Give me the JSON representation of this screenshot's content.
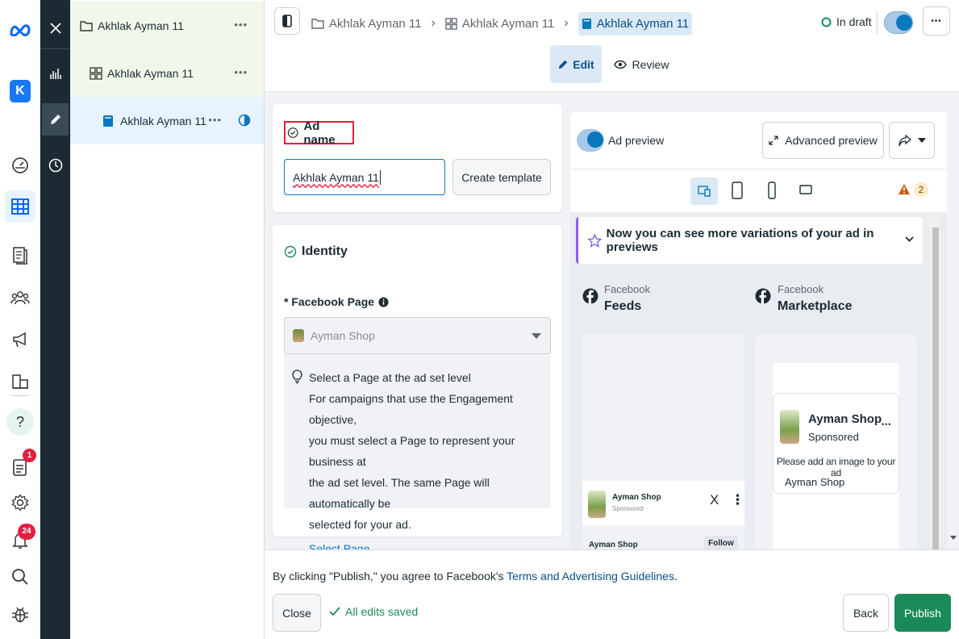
{
  "colors": {
    "accent": "#0a78be",
    "brand_blue": "#0866ff",
    "publish": "#1a8a5a",
    "badge": "#e41e3f",
    "dark_toolbar": "#1c2b33",
    "selected_row": "#e7f3ff",
    "tree_top": "#f1f8e9"
  },
  "rail": {
    "account_initial": "K",
    "notifications_badge": "1",
    "alerts_badge": "24",
    "icons": [
      "meta-logo-icon",
      "account-avatar-icon",
      "dashboard-icon",
      "grid-table-icon",
      "pages-icon",
      "audience-icon",
      "megaphone-icon",
      "catalog-icon",
      "help-icon",
      "notifications-icon",
      "settings-icon",
      "alerts-bell-icon",
      "search-icon",
      "bug-icon"
    ]
  },
  "tree": {
    "campaign": {
      "label": "Akhlak Ayman 11",
      "more": "•••"
    },
    "adset": {
      "label": "Akhlak Ayman 11",
      "more": "•••"
    },
    "ad": {
      "label": "Akhlak Ayman 11",
      "more": "•••"
    }
  },
  "header": {
    "breadcrumb": [
      "Akhlak Ayman 11",
      "Akhlak Ayman 11",
      "Akhlak Ayman 11"
    ],
    "status": "In draft",
    "more": "•••",
    "tabs": {
      "edit": "Edit",
      "review": "Review"
    }
  },
  "ad_name": {
    "title": "Ad name",
    "value": "Akhlak Ayman 11",
    "template_button": "Create template"
  },
  "identity": {
    "title": "Identity",
    "page_label": "* Facebook Page",
    "page_value": "Ayman Shop",
    "info_title": "Select a Page at the ad set level",
    "info_lines": [
      "For campaigns that use the Engagement objective,",
      "you must select a Page to represent your business at",
      "the ad set level. The same Page will automatically be",
      "selected for your ad."
    ],
    "link": "Select Page"
  },
  "preview": {
    "toggle_label": "Ad preview",
    "advanced": "Advanced preview",
    "warning_count": "2",
    "banner": "Now you can see more variations of your ad in previews",
    "placements": [
      {
        "platform": "Facebook",
        "name": "Feeds"
      },
      {
        "platform": "Facebook",
        "name": "Marketplace"
      }
    ],
    "feed_card": {
      "page": "Ayman Shop",
      "sponsored": "Sponsored · ",
      "close": "X",
      "cut_name": "Ayman Shop",
      "follow": "Follow"
    },
    "market_card": {
      "page": "Ayman Shop",
      "sponsored": "Sponsored",
      "more": "•••",
      "message": "Please add an image to your ad",
      "footer": "Ayman Shop"
    }
  },
  "footer": {
    "terms_prefix": "By clicking \"Publish,\" you agree to Facebook's ",
    "terms_link": "Terms and Advertising Guidelines",
    "terms_suffix": ".",
    "close": "Close",
    "saved": "All edits saved",
    "back": "Back",
    "publish": "Publish"
  }
}
